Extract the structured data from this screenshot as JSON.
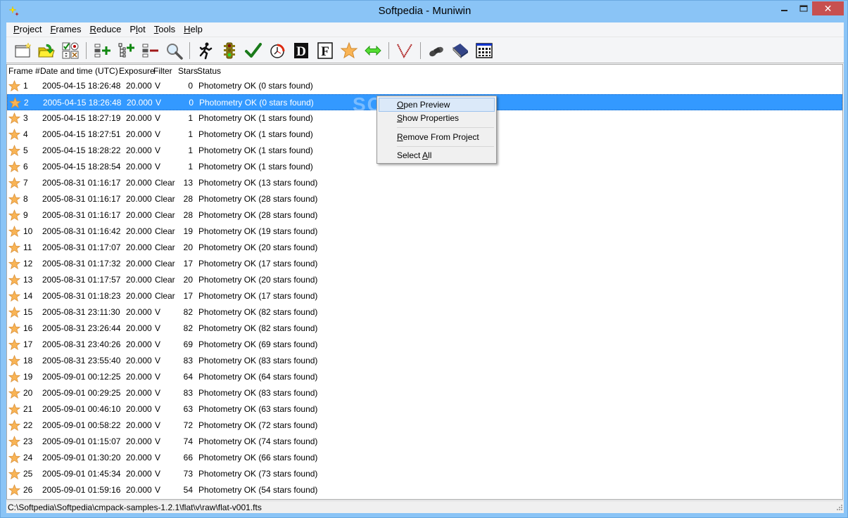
{
  "window": {
    "title": "Softpedia - Muniwin",
    "minimize_label": "_",
    "maximize_label": "▭",
    "close_label": "✕"
  },
  "menu": [
    {
      "label": "Project",
      "accel": "P",
      "rest": "roject"
    },
    {
      "label": "Frames",
      "accel": "F",
      "rest": "rames"
    },
    {
      "label": "Reduce",
      "accel": "R",
      "rest": "educe"
    },
    {
      "label": "Plot",
      "accel": "P",
      "rest": "lot",
      "accel_index": 1
    },
    {
      "label": "Tools",
      "accel": "T",
      "rest": "ools"
    },
    {
      "label": "Help",
      "accel": "H",
      "rest": "elp"
    }
  ],
  "toolbar": [
    {
      "name": "new-project",
      "icon": "new-window-icon"
    },
    {
      "name": "open-project",
      "icon": "open-folder-icon"
    },
    {
      "name": "edit-project",
      "icon": "checkbox-grid-icon"
    },
    {
      "sep": true
    },
    {
      "name": "add-frames",
      "icon": "add-frames-icon"
    },
    {
      "name": "add-folder",
      "icon": "add-tree-icon"
    },
    {
      "name": "remove-frames",
      "icon": "remove-frames-icon"
    },
    {
      "name": "preview",
      "icon": "magnifier-icon"
    },
    {
      "sep": true
    },
    {
      "name": "express-reduction",
      "icon": "runner-icon"
    },
    {
      "name": "conversion",
      "icon": "traffic-light-icon"
    },
    {
      "name": "check",
      "icon": "checkmark-icon"
    },
    {
      "name": "time-correction",
      "icon": "clock-icon"
    },
    {
      "name": "dark-correction",
      "icon": "dark-d-icon",
      "glyph": "D"
    },
    {
      "name": "flat-correction",
      "icon": "flat-f-icon",
      "glyph": "F"
    },
    {
      "name": "photometry",
      "icon": "star-icon"
    },
    {
      "name": "matching",
      "icon": "double-arrow-icon"
    },
    {
      "sep": true
    },
    {
      "name": "light-curve",
      "icon": "v-curve-icon"
    },
    {
      "sep": true
    },
    {
      "name": "find-variables",
      "icon": "binoculars-icon"
    },
    {
      "name": "catalog",
      "icon": "book-icon"
    },
    {
      "name": "table",
      "icon": "table-grid-icon"
    }
  ],
  "list": {
    "columns": [
      "Frame #",
      "Date and time (UTC)",
      "Exposure",
      "Filter",
      "Stars",
      "Status"
    ],
    "selected_index": 1,
    "rows": [
      {
        "frame": "1",
        "date": "2005-04-15 18:26:48",
        "exposure": "20.000",
        "filter": "V",
        "stars": "0",
        "status": "Photometry OK (0 stars found)"
      },
      {
        "frame": "2",
        "date": "2005-04-15 18:26:48",
        "exposure": "20.000",
        "filter": "V",
        "stars": "0",
        "status": "Photometry OK (0 stars found)"
      },
      {
        "frame": "3",
        "date": "2005-04-15 18:27:19",
        "exposure": "20.000",
        "filter": "V",
        "stars": "1",
        "status": "Photometry OK (1 stars found)"
      },
      {
        "frame": "4",
        "date": "2005-04-15 18:27:51",
        "exposure": "20.000",
        "filter": "V",
        "stars": "1",
        "status": "Photometry OK (1 stars found)"
      },
      {
        "frame": "5",
        "date": "2005-04-15 18:28:22",
        "exposure": "20.000",
        "filter": "V",
        "stars": "1",
        "status": "Photometry OK (1 stars found)"
      },
      {
        "frame": "6",
        "date": "2005-04-15 18:28:54",
        "exposure": "20.000",
        "filter": "V",
        "stars": "1",
        "status": "Photometry OK (1 stars found)"
      },
      {
        "frame": "7",
        "date": "2005-08-31 01:16:17",
        "exposure": "20.000",
        "filter": "Clear",
        "stars": "13",
        "status": "Photometry OK (13 stars found)"
      },
      {
        "frame": "8",
        "date": "2005-08-31 01:16:17",
        "exposure": "20.000",
        "filter": "Clear",
        "stars": "28",
        "status": "Photometry OK (28 stars found)"
      },
      {
        "frame": "9",
        "date": "2005-08-31 01:16:17",
        "exposure": "20.000",
        "filter": "Clear",
        "stars": "28",
        "status": "Photometry OK (28 stars found)"
      },
      {
        "frame": "10",
        "date": "2005-08-31 01:16:42",
        "exposure": "20.000",
        "filter": "Clear",
        "stars": "19",
        "status": "Photometry OK (19 stars found)"
      },
      {
        "frame": "11",
        "date": "2005-08-31 01:17:07",
        "exposure": "20.000",
        "filter": "Clear",
        "stars": "20",
        "status": "Photometry OK (20 stars found)"
      },
      {
        "frame": "12",
        "date": "2005-08-31 01:17:32",
        "exposure": "20.000",
        "filter": "Clear",
        "stars": "17",
        "status": "Photometry OK (17 stars found)"
      },
      {
        "frame": "13",
        "date": "2005-08-31 01:17:57",
        "exposure": "20.000",
        "filter": "Clear",
        "stars": "20",
        "status": "Photometry OK (20 stars found)"
      },
      {
        "frame": "14",
        "date": "2005-08-31 01:18:23",
        "exposure": "20.000",
        "filter": "Clear",
        "stars": "17",
        "status": "Photometry OK (17 stars found)"
      },
      {
        "frame": "15",
        "date": "2005-08-31 23:11:30",
        "exposure": "20.000",
        "filter": "V",
        "stars": "82",
        "status": "Photometry OK (82 stars found)"
      },
      {
        "frame": "16",
        "date": "2005-08-31 23:26:44",
        "exposure": "20.000",
        "filter": "V",
        "stars": "82",
        "status": "Photometry OK (82 stars found)"
      },
      {
        "frame": "17",
        "date": "2005-08-31 23:40:26",
        "exposure": "20.000",
        "filter": "V",
        "stars": "69",
        "status": "Photometry OK (69 stars found)"
      },
      {
        "frame": "18",
        "date": "2005-08-31 23:55:40",
        "exposure": "20.000",
        "filter": "V",
        "stars": "83",
        "status": "Photometry OK (83 stars found)"
      },
      {
        "frame": "19",
        "date": "2005-09-01 00:12:25",
        "exposure": "20.000",
        "filter": "V",
        "stars": "64",
        "status": "Photometry OK (64 stars found)"
      },
      {
        "frame": "20",
        "date": "2005-09-01 00:29:25",
        "exposure": "20.000",
        "filter": "V",
        "stars": "83",
        "status": "Photometry OK (83 stars found)"
      },
      {
        "frame": "21",
        "date": "2005-09-01 00:46:10",
        "exposure": "20.000",
        "filter": "V",
        "stars": "63",
        "status": "Photometry OK (63 stars found)"
      },
      {
        "frame": "22",
        "date": "2005-09-01 00:58:22",
        "exposure": "20.000",
        "filter": "V",
        "stars": "72",
        "status": "Photometry OK (72 stars found)"
      },
      {
        "frame": "23",
        "date": "2005-09-01 01:15:07",
        "exposure": "20.000",
        "filter": "V",
        "stars": "74",
        "status": "Photometry OK (74 stars found)"
      },
      {
        "frame": "24",
        "date": "2005-09-01 01:30:20",
        "exposure": "20.000",
        "filter": "V",
        "stars": "66",
        "status": "Photometry OK (66 stars found)"
      },
      {
        "frame": "25",
        "date": "2005-09-01 01:45:34",
        "exposure": "20.000",
        "filter": "V",
        "stars": "73",
        "status": "Photometry OK (73 stars found)"
      },
      {
        "frame": "26",
        "date": "2005-09-01 01:59:16",
        "exposure": "20.000",
        "filter": "V",
        "stars": "54",
        "status": "Photometry OK (54 stars found)"
      }
    ]
  },
  "context_menu": {
    "items": [
      {
        "label": "Open Preview",
        "accel": "O",
        "rest": "pen Preview"
      },
      {
        "label": "Show Properties",
        "accel": "S",
        "rest": "how Properties"
      },
      {
        "label": "Remove From Project",
        "accel": "R",
        "rest": "emove From Project"
      },
      {
        "label": "Select All",
        "pre": "Select ",
        "accel": "A",
        "rest": "ll"
      }
    ]
  },
  "statusbar": {
    "path": "C:\\Softpedia\\Softpedia\\cmpack-samples-1.2.1\\flat\\v\\raw\\flat-v001.fts"
  },
  "watermark": "SOFTPEDIA",
  "colors": {
    "titlebar": "#8ac4f6",
    "selection": "#3399ff",
    "close_button": "#c75050",
    "star_fill": "#f9b455"
  }
}
